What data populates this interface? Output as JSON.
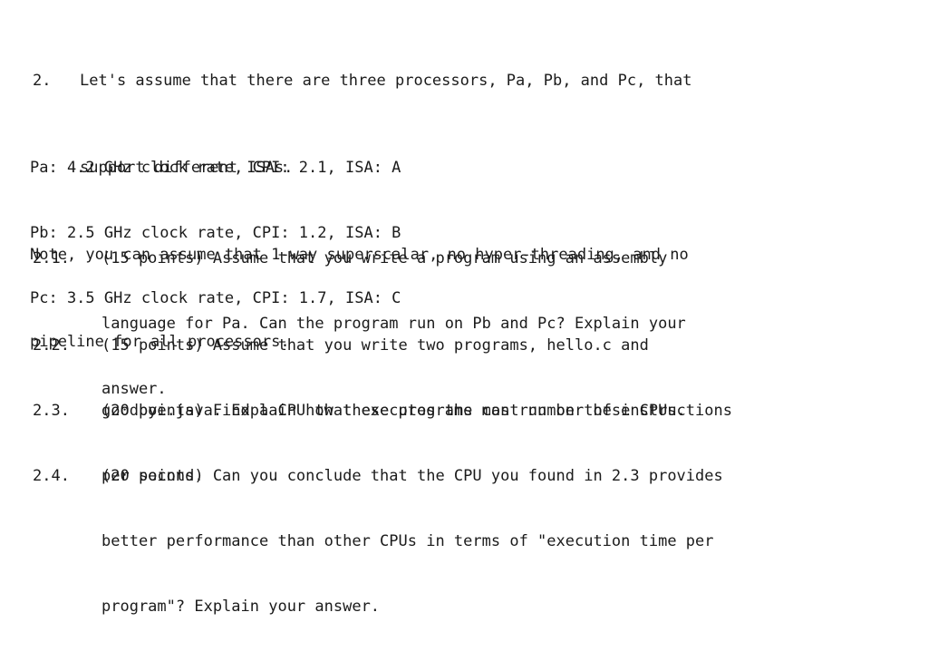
{
  "document": {
    "type": "exam-question",
    "background_color": "#ffffff",
    "text_color": "#1b1b1b"
  },
  "question": {
    "number": "2.",
    "stem_line_1": "Let's assume that there are three processors, Pa, Pb, and Pc, that",
    "stem_line_2": "support different ISAs.",
    "note_line_1": "Note, you can assume that 1-way superscalar, no hyper-threading, and no",
    "note_line_2": "pipeline for all processors."
  },
  "processors": {
    "lines": [
      "Pa: 4.2 GHz clock rate, CPI: 2.1, ISA: A",
      "Pb: 2.5 GHz clock rate, CPI: 1.2, ISA: B",
      "Pc: 3.5 GHz clock rate, CPI: 1.7, ISA: C"
    ],
    "entries": [
      {
        "name": "Pa",
        "clock_rate": "4.2 GHz",
        "cpi": "2.1",
        "isa": "A"
      },
      {
        "name": "Pb",
        "clock_rate": "2.5 GHz",
        "cpi": "1.2",
        "isa": "B"
      },
      {
        "name": "Pc",
        "clock_rate": "3.5 GHz",
        "cpi": "1.7",
        "isa": "C"
      }
    ]
  },
  "subquestions": [
    {
      "label": "2.1.",
      "points": "15 points",
      "line_1": "(15 points) Assume that you write a program using an assembly",
      "line_2": "language for Pa. Can the program run on Pb and Pc? Explain your",
      "line_3": "answer."
    },
    {
      "label": "2.2.",
      "points": "15 points",
      "line_1": "(15 points) Assume that you write two programs, hello.c and",
      "line_2": "goodbye.java. Explain how these programs can run on these CPUs.",
      "line_3": ""
    },
    {
      "label": "2.3.",
      "points": "20 points",
      "line_1": "(20 points) Find a CPU that executes the most number of instructions",
      "line_2": "per second.",
      "line_3": ""
    },
    {
      "label": "2.4.",
      "points": "20 points",
      "line_1": "(20 points) Can you conclude that the CPU you found in 2.3 provides",
      "line_2": "better performance than other CPUs in terms of \"execution time per",
      "line_3": "program\"? Explain your answer."
    }
  ]
}
